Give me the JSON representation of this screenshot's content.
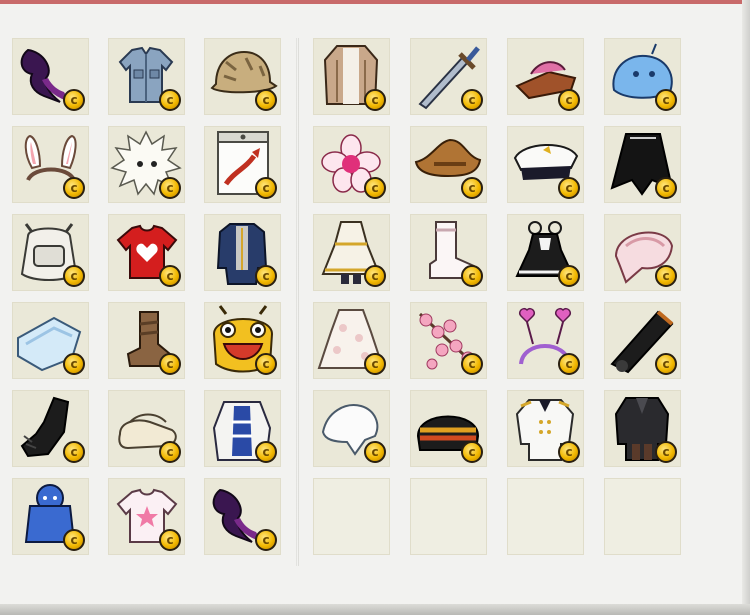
{
  "window": {
    "accent_color": "#c86a6a"
  },
  "coin": {
    "glyph": "c",
    "icon": "coin-icon"
  },
  "left_panel": {
    "slots": [
      {
        "item": "dark-feather-hat"
      },
      {
        "item": "denim-shirt"
      },
      {
        "item": "camo-helmet"
      },
      {
        "item": "bunny-ears-headband"
      },
      {
        "item": "white-puffball"
      },
      {
        "item": "sealed-package"
      },
      {
        "item": "white-backpack"
      },
      {
        "item": "heart-t-shirt"
      },
      {
        "item": "navy-coat"
      },
      {
        "item": "blue-pillow"
      },
      {
        "item": "brown-boots"
      },
      {
        "item": "bee-mask"
      },
      {
        "item": "black-glove"
      },
      {
        "item": "cream-shoes"
      },
      {
        "item": "blue-white-robe"
      },
      {
        "item": "blue-hoodie"
      },
      {
        "item": "star-t-shirt"
      },
      {
        "item": "dark-feather-hat"
      }
    ]
  },
  "right_panel": {
    "slots": [
      {
        "item": "long-cardigan"
      },
      {
        "item": "steel-sword"
      },
      {
        "item": "sandals"
      },
      {
        "item": "blue-slime-hat"
      },
      {
        "item": "pink-flower-hairpin"
      },
      {
        "item": "cowboy-hat"
      },
      {
        "item": "captain-cap"
      },
      {
        "item": "black-cape"
      },
      {
        "item": "gold-trim-dress"
      },
      {
        "item": "white-boots"
      },
      {
        "item": "black-maid-dress"
      },
      {
        "item": "pink-wrap-scarf"
      },
      {
        "item": "lace-dress"
      },
      {
        "item": "cherry-blossom-branch"
      },
      {
        "item": "heart-antenna-headband"
      },
      {
        "item": "black-cannon"
      },
      {
        "item": "white-bandana"
      },
      {
        "item": "striped-helmet"
      },
      {
        "item": "white-uniform"
      },
      {
        "item": "dark-suit"
      },
      {
        "item": ""
      },
      {
        "item": ""
      },
      {
        "item": ""
      },
      {
        "item": ""
      }
    ]
  }
}
